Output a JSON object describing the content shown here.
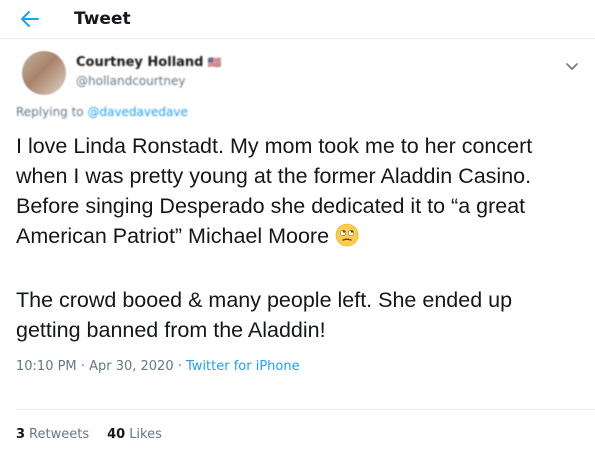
{
  "header": {
    "title": "Tweet"
  },
  "author": {
    "display_name": "Courtney Holland",
    "flag": "🇺🇸",
    "handle": "@hollandcourtney"
  },
  "reply": {
    "prefix": "Replying to",
    "target": "@davedavedave"
  },
  "body": {
    "paragraph_1": "I love Linda Ronstadt. My mom took me to her concert when I was pretty young at the former Aladdin Casino. Before singing Desperado she dedicated it to “a great American Patriot” Michael Moore",
    "emoji": "eye-roll-emoji",
    "paragraph_2": "The crowd booed & many people left. She ended up getting banned from the Aladdin!"
  },
  "meta": {
    "time": "10:10 PM",
    "date": "Apr 30, 2020",
    "source": "Twitter for iPhone",
    "separator": "·"
  },
  "stats": {
    "retweets_count": "3",
    "retweets_label": "Retweets",
    "likes_count": "40",
    "likes_label": "Likes"
  },
  "colors": {
    "accent": "#1da1f2",
    "muted": "#657786",
    "text": "#14171a",
    "border": "#e6ecf0"
  }
}
